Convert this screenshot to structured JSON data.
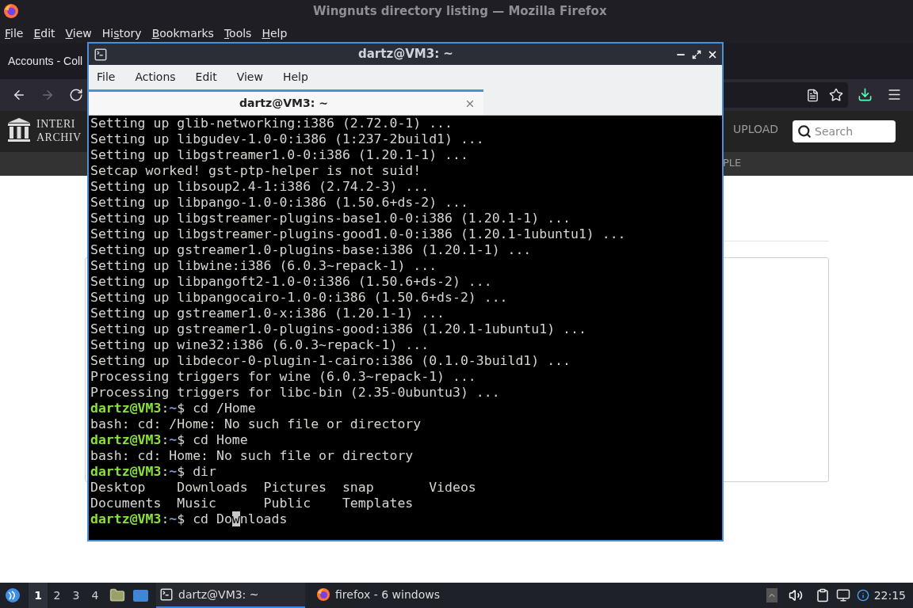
{
  "firefox": {
    "title": "Wingnuts directory listing — Mozilla Firefox",
    "menu": [
      {
        "key": "F",
        "post": "ile"
      },
      {
        "key": "E",
        "post": "dit"
      },
      {
        "key": "V",
        "post": "iew"
      },
      {
        "pre": "Hi",
        "key": "s",
        "post": "tory"
      },
      {
        "key": "B",
        "post": "ookmarks"
      },
      {
        "key": "T",
        "post": "ools"
      },
      {
        "key": "H",
        "post": "elp"
      }
    ],
    "tab": {
      "label": "Accounts - Coll"
    },
    "nav": [
      {
        "kind": "back",
        "disabled": false
      },
      {
        "kind": "forward",
        "disabled": true
      },
      {
        "kind": "reload",
        "disabled": false
      }
    ],
    "site": {
      "logo": [
        "INTERI",
        "ARCHIV"
      ],
      "upload": "UPLOAD",
      "search": {
        "placeholder": "Search"
      },
      "subnav": "PLE"
    }
  },
  "terminal": {
    "title": "dartz@VM3: ~",
    "menu": [
      "File",
      "Actions",
      "Edit",
      "View",
      "Help"
    ],
    "tabs": [
      {
        "label": "dartz@VM3: ~",
        "selected": true
      }
    ],
    "lines": [
      {
        "kind": "output",
        "text": "Setting up glib-networking:i386 (2.72.0-1) ..."
      },
      {
        "kind": "output",
        "text": "Setting up libgudev-1.0-0:i386 (1:237-2build1) ..."
      },
      {
        "kind": "output",
        "text": "Setting up libgstreamer1.0-0:i386 (1.20.1-1) ..."
      },
      {
        "kind": "output",
        "text": "Setcap worked! gst-ptp-helper is not suid!"
      },
      {
        "kind": "output",
        "text": "Setting up libsoup2.4-1:i386 (2.74.2-3) ..."
      },
      {
        "kind": "output",
        "text": "Setting up libpango-1.0-0:i386 (1.50.6+ds-2) ..."
      },
      {
        "kind": "output",
        "text": "Setting up libgstreamer-plugins-base1.0-0:i386 (1.20.1-1) ..."
      },
      {
        "kind": "output",
        "text": "Setting up libgstreamer-plugins-good1.0-0:i386 (1.20.1-1ubuntu1) ..."
      },
      {
        "kind": "output",
        "text": "Setting up gstreamer1.0-plugins-base:i386 (1.20.1-1) ..."
      },
      {
        "kind": "output",
        "text": "Setting up libwine:i386 (6.0.3~repack-1) ..."
      },
      {
        "kind": "output",
        "text": "Setting up libpangoft2-1.0-0:i386 (1.50.6+ds-2) ..."
      },
      {
        "kind": "output",
        "text": "Setting up libpangocairo-1.0-0:i386 (1.50.6+ds-2) ..."
      },
      {
        "kind": "output",
        "text": "Setting up gstreamer1.0-x:i386 (1.20.1-1) ..."
      },
      {
        "kind": "output",
        "text": "Setting up gstreamer1.0-plugins-good:i386 (1.20.1-1ubuntu1) ..."
      },
      {
        "kind": "output",
        "text": "Setting up wine32:i386 (6.0.3~repack-1) ..."
      },
      {
        "kind": "output",
        "text": "Setting up libdecor-0-plugin-1-cairo:i386 (0.1.0-3build1) ..."
      },
      {
        "kind": "output",
        "text": "Processing triggers for wine (6.0.3~repack-1) ..."
      },
      {
        "kind": "output",
        "text": "Processing triggers for libc-bin (2.35-0ubuntu3) ..."
      },
      {
        "kind": "prompt",
        "user": "dartz@VM3",
        "sep": ":",
        "path": "~",
        "symbol": "$",
        "command": "cd /Home"
      },
      {
        "kind": "output",
        "text": "bash: cd: /Home: No such file or directory"
      },
      {
        "kind": "prompt",
        "user": "dartz@VM3",
        "sep": ":",
        "path": "~",
        "symbol": "$",
        "command": "cd Home"
      },
      {
        "kind": "output",
        "text": "bash: cd: Home: No such file or directory"
      },
      {
        "kind": "prompt",
        "user": "dartz@VM3",
        "sep": ":",
        "path": "~",
        "symbol": "$",
        "command": "dir"
      },
      {
        "kind": "output",
        "text": "Desktop    Downloads  Pictures  snap       Videos"
      },
      {
        "kind": "output",
        "text": "Documents  Music      Public    Templates"
      },
      {
        "kind": "prompt",
        "user": "dartz@VM3",
        "sep": ":",
        "path": "~",
        "symbol": "$",
        "command": "cd Do",
        "cursor": "w",
        "after_cursor": "nloads"
      }
    ]
  },
  "taskbar": {
    "workspaces": [
      {
        "label": "1",
        "selected": true
      },
      {
        "label": "2",
        "selected": false
      },
      {
        "label": "3",
        "selected": false
      },
      {
        "label": "4",
        "selected": false
      }
    ],
    "tasks": [
      {
        "kind": "terminal",
        "label": "dartz@VM3: ~",
        "selected": true
      },
      {
        "kind": "firefox",
        "label": "firefox - 6 windows",
        "selected": false
      }
    ],
    "clock": "22:15"
  }
}
